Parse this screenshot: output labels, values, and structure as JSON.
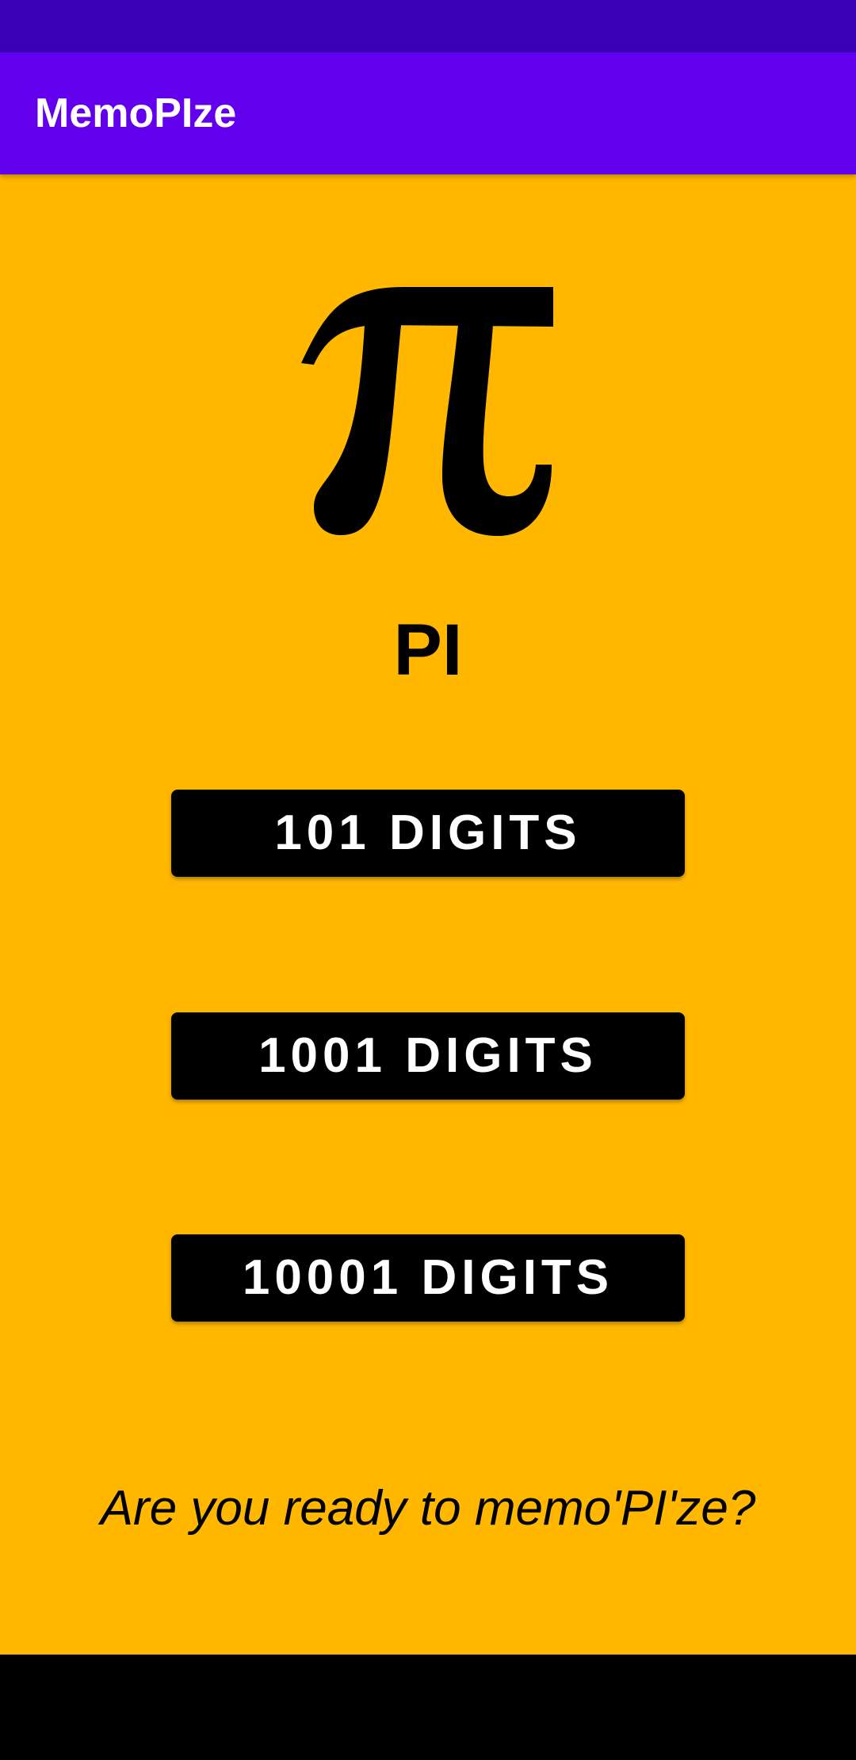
{
  "app_bar": {
    "title": "MemoPIze"
  },
  "main": {
    "symbol_icon": "pi-symbol-icon",
    "heading": "PI",
    "buttons": [
      {
        "label": "101 DIGITS"
      },
      {
        "label": "1001 DIGITS"
      },
      {
        "label": "10001 DIGITS"
      }
    ],
    "tagline": "Are you ready to memo'PI'ze?"
  },
  "colors": {
    "status_bar": "#3A00B4",
    "app_bar": "#6200EE",
    "background": "#FFB700",
    "button": "#000000",
    "button_text": "#FFFFFF",
    "navigation_bar": "#000000"
  }
}
